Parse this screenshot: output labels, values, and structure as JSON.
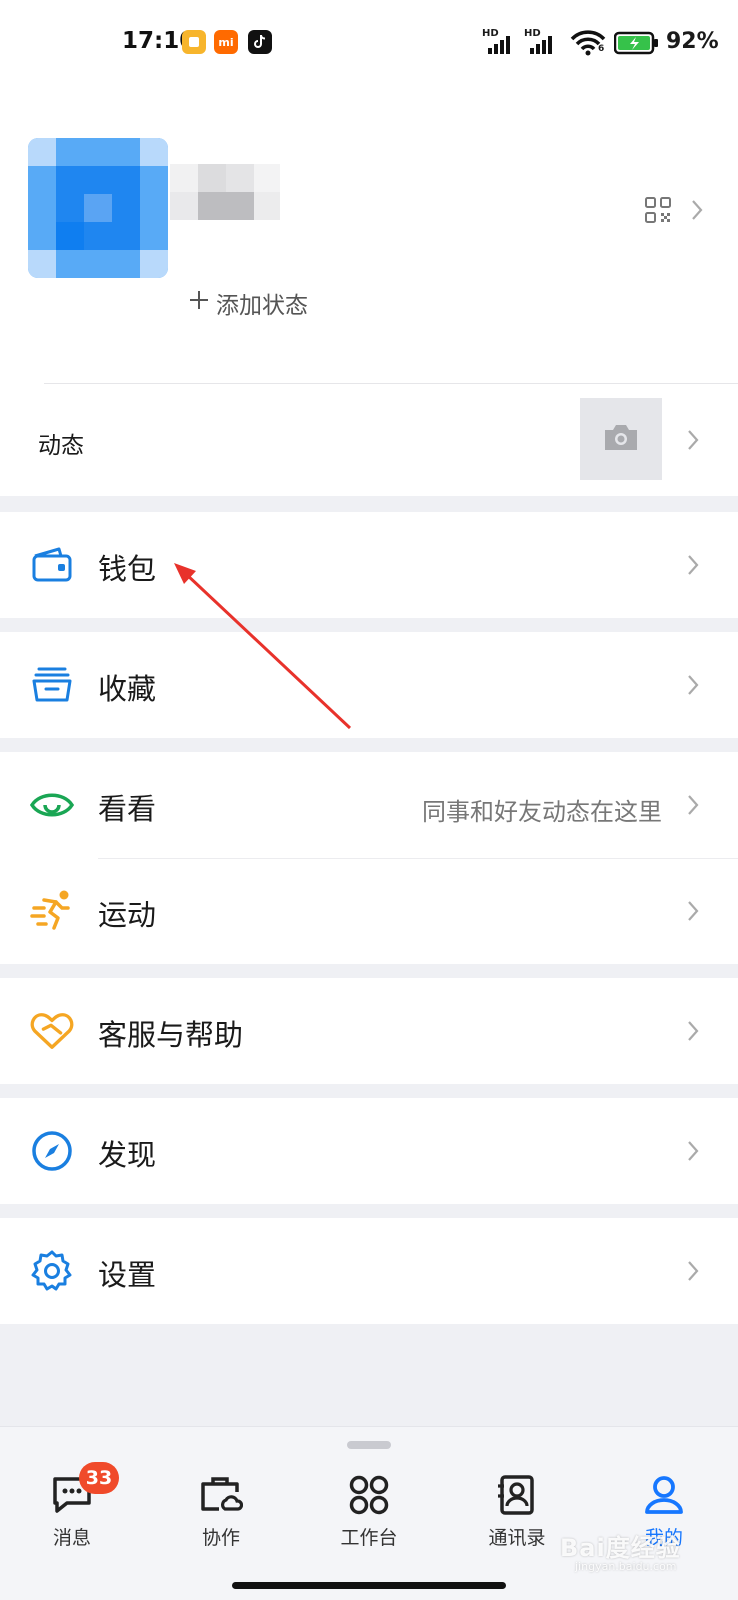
{
  "status_bar": {
    "time": "17:10",
    "network_1": "HD",
    "network_2": "HD",
    "wifi_gen": "6",
    "battery": "92%"
  },
  "profile": {
    "add_status": "添加状态"
  },
  "moments": {
    "label": "动态"
  },
  "menu": {
    "wallet": "钱包",
    "favorites": "收藏",
    "look": "看看",
    "look_hint": "同事和好友动态在这里",
    "sports": "运动",
    "service": "客服与帮助",
    "discover": "发现",
    "settings": "设置"
  },
  "tabs": {
    "messages": "消息",
    "messages_badge": "33",
    "collab": "协作",
    "workbench": "工作台",
    "contacts": "通讯录",
    "me": "我的"
  },
  "watermark": {
    "text": "Bai度经验",
    "sub": "jingyan.baidu.com"
  },
  "colors": {
    "accent": "#1677ff",
    "wallet_icon": "#1a7fe0",
    "look_icon": "#1aa654",
    "sports_icon": "#f5a623",
    "service_icon": "#f5a623",
    "badge": "#f04a2a",
    "annotation_arrow": "#e8322b"
  }
}
